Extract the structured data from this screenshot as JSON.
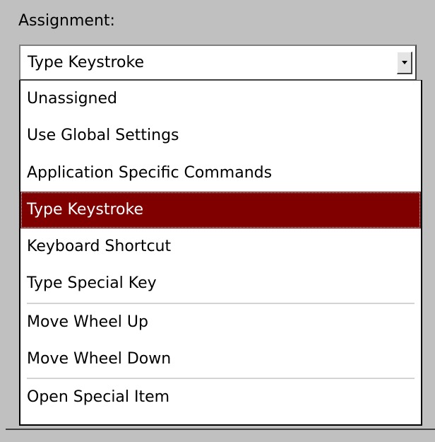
{
  "assignment": {
    "label": "Assignment:",
    "selected_value": "Type Keystroke"
  },
  "dropdown": {
    "options": [
      {
        "label": "Unassigned"
      },
      {
        "label": "Use Global Settings"
      },
      {
        "label": "Application Specific Commands"
      },
      {
        "label": "Type Keystroke",
        "selected": true
      },
      {
        "label": "Keyboard Shortcut"
      },
      {
        "label": "Type Special Key"
      },
      {
        "label": "Move Wheel Up"
      },
      {
        "label": "Move Wheel Down"
      },
      {
        "label": "Open Special Item"
      }
    ]
  },
  "icons": {
    "combo_arrow": "chevron-down-icon"
  },
  "colors": {
    "selected_background": "#800000",
    "selected_text": "#ffffff",
    "window_background": "#c0c0c0"
  }
}
